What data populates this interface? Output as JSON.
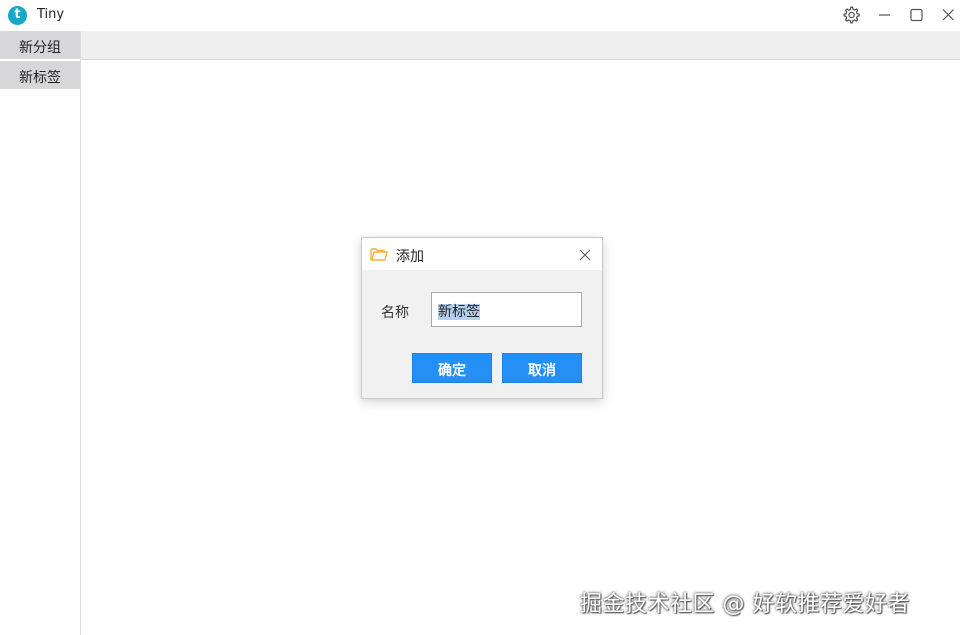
{
  "window": {
    "title": "Tiny",
    "logo_letter": "t"
  },
  "sidebar": {
    "items": [
      {
        "label": "新分组"
      },
      {
        "label": "新标签"
      }
    ]
  },
  "dialog": {
    "title": "添加",
    "field_label": "名称",
    "input_value": "新标签",
    "ok_label": "确定",
    "cancel_label": "取消"
  },
  "watermark": "掘金技术社区 @ 好软推荐爱好者",
  "colors": {
    "accent": "#2490f6",
    "logo": "#1aa6c8",
    "sidebar_item_bg": "#d7d7d9",
    "tabstrip_bg": "#efeff0",
    "folder_icon": "#f2b531",
    "selection": "#b5cfee"
  },
  "icons": [
    "app-logo",
    "settings-icon",
    "minimize-icon",
    "maximize-icon",
    "close-icon",
    "folder-icon",
    "dialog-close-icon"
  ]
}
